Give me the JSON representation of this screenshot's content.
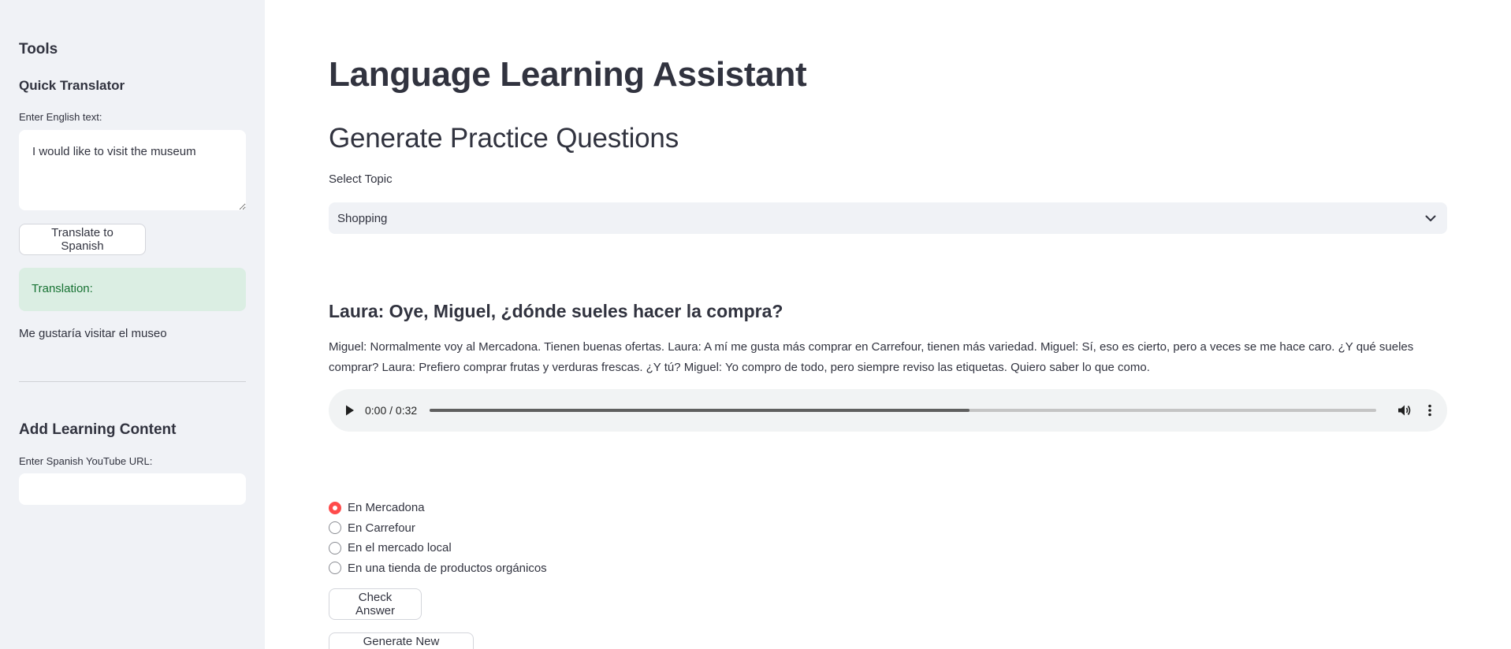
{
  "sidebar": {
    "tools_heading": "Tools",
    "quick_translator_heading": "Quick Translator",
    "english_text_label": "Enter English text:",
    "english_text_value": "I would like to visit the museum",
    "translate_button": "Translate to Spanish",
    "translation_label": "Translation:",
    "translation_result": "Me gustaría visitar el museo",
    "add_content_heading": "Add Learning Content",
    "youtube_label": "Enter Spanish YouTube URL:",
    "youtube_value": ""
  },
  "main": {
    "title": "Language Learning Assistant",
    "section_heading": "Generate Practice Questions",
    "topic_label": "Select Topic",
    "topic_selected": "Shopping",
    "question_heading": "Laura: Oye, Miguel, ¿dónde sueles hacer la compra?",
    "dialogue_text": "Miguel: Normalmente voy al Mercadona. Tienen buenas ofertas. Laura: A mí me gusta más comprar en Carrefour, tienen más variedad. Miguel: Sí, eso es cierto, pero a veces se me hace caro. ¿Y qué sueles comprar? Laura: Prefiero comprar frutas y verduras frescas. ¿Y tú? Miguel: Yo compro de todo, pero siempre reviso las etiquetas. Quiero saber lo que como.",
    "audio": {
      "time_display": "0:00 / 0:32",
      "buffered_fraction": 0.57
    },
    "options": [
      {
        "label": "En Mercadona",
        "selected": true
      },
      {
        "label": "En Carrefour",
        "selected": false
      },
      {
        "label": "En el mercado local",
        "selected": false
      },
      {
        "label": "En una tienda de productos orgánicos",
        "selected": false
      }
    ],
    "check_button": "Check Answer",
    "generate_button": "Generate New Question"
  },
  "colors": {
    "sidebar_bg": "#f0f2f6",
    "accent": "#ff4b4b",
    "success_bg": "#dbeee3",
    "success_text": "#177233",
    "text": "#31333f"
  },
  "icons": {
    "select": "chevron-down-icon",
    "play": "play-icon",
    "volume": "volume-icon",
    "more": "more-vertical-icon"
  }
}
